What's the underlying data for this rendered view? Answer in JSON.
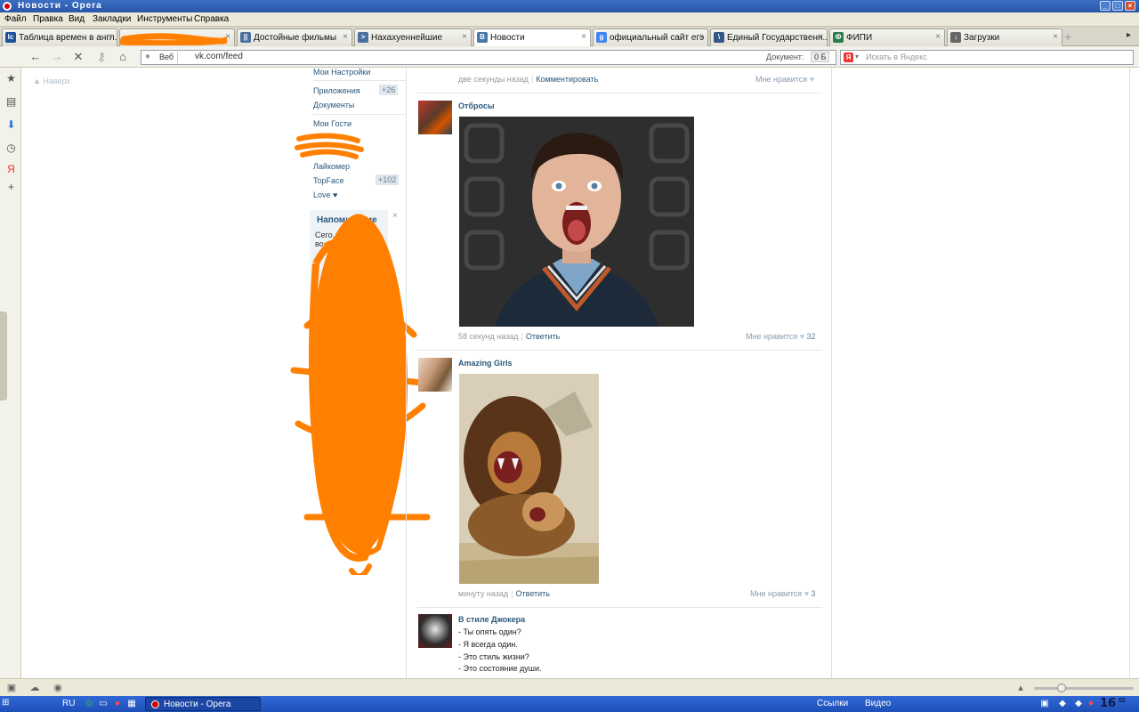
{
  "window": {
    "title": "Новости - Opera"
  },
  "menu": [
    "Файл",
    "Правка",
    "Вид",
    "Закладки",
    "Инструменты",
    "Справка"
  ],
  "tabs": [
    {
      "label": "Таблица времен в англ...",
      "icon": "lc",
      "color": "#1a4f9c"
    },
    {
      "label": "",
      "icon": "",
      "color": "#ff8c00"
    },
    {
      "label": "Достойные фильмы",
      "icon": "||",
      "color": "#4a6fa0"
    },
    {
      "label": "Нахахуеннейшие",
      "icon": ">",
      "color": "#4a6fa0"
    },
    {
      "label": "Новости",
      "icon": "В",
      "color": "#4a76a8"
    },
    {
      "label": "официальный сайт егэ ...",
      "icon": "g",
      "color": "#4285f4"
    },
    {
      "label": "Единый Государственн...",
      "icon": "\\",
      "color": "#335588"
    },
    {
      "label": "ФИПИ",
      "icon": "Ф",
      "color": "#2f7a4f"
    },
    {
      "label": "Загрузки",
      "icon": "↓",
      "color": "#666666"
    }
  ],
  "address": {
    "veb_label": "Веб",
    "url": "vk.com/feed",
    "doc_label": "Документ:",
    "doc_value": "0 Б",
    "search_placeholder": "Искать в Яндекс"
  },
  "page": {
    "back_to_top": "Наверх",
    "left_menu": [
      {
        "label": "Мои Настройки",
        "count": ""
      },
      {
        "label": "Приложения",
        "count": "+26"
      },
      {
        "label": "Документы",
        "count": ""
      },
      {
        "label": "Мои Гости",
        "count": ""
      },
      {
        "label": "Лайкомер",
        "count": ""
      },
      {
        "label": "TopFace",
        "count": "+102"
      },
      {
        "label": "Love ♥",
        "count": ""
      }
    ],
    "reminder": {
      "title": "Напоминание",
      "text": "Сего... остоится во... ир по А..."
    },
    "posts": [
      {
        "author": "",
        "time": "две секунды назад",
        "action": "Комментировать",
        "likes_label": "Мне нравится",
        "likes_count": ""
      },
      {
        "author": "Отбросы",
        "time": "58 секунд назад",
        "action": "Ответить",
        "likes_label": "Мне нравится",
        "likes_count": "32"
      },
      {
        "author": "Amazing Girls",
        "time": "минуту назад",
        "action": "Ответить",
        "likes_label": "Мне нравится",
        "likes_count": "3"
      },
      {
        "author": "В стиле Джокера",
        "lines": [
          "- Ты опять один?",
          "- Я всегда один.",
          "- Это стиль жизни?",
          "- Это состояние души."
        ]
      }
    ]
  },
  "taskbar": {
    "lang": "RU",
    "task": "Новости - Opera",
    "links": "Ссылки",
    "video": "Видео",
    "clock": "16",
    "clock_small": "02"
  },
  "colors": {
    "link": "#2b587a",
    "scribble": "#ff8000",
    "accent": "#4a76a8"
  }
}
